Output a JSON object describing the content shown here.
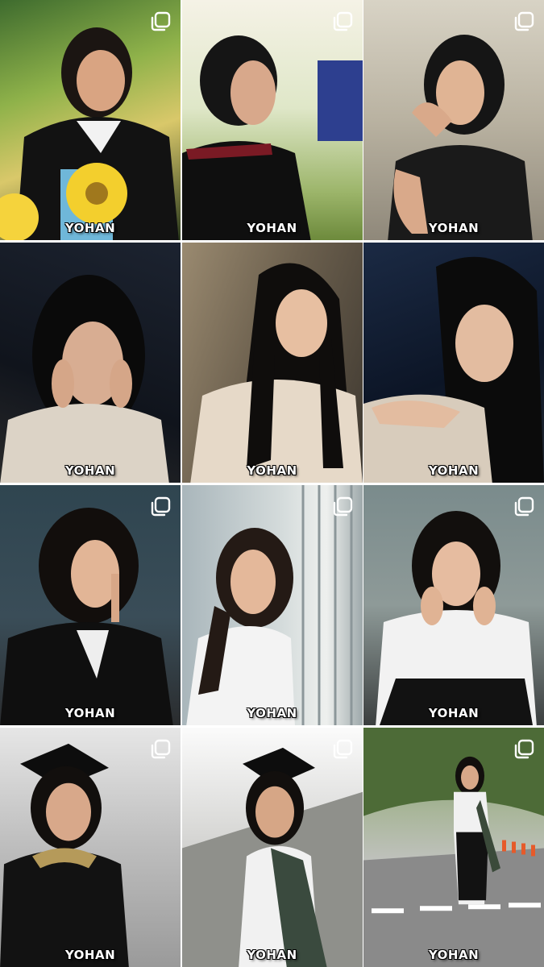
{
  "grid": {
    "tiles": [
      {
        "watermark": "YOHAN",
        "multi_photo": true
      },
      {
        "watermark": "YOHAN",
        "multi_photo": true
      },
      {
        "watermark": "YOHAN",
        "multi_photo": true
      },
      {
        "watermark": "YOHAN",
        "multi_photo": false
      },
      {
        "watermark": "YOHAN",
        "multi_photo": false
      },
      {
        "watermark": "YOHAN",
        "multi_photo": false
      },
      {
        "watermark": "YOHAN",
        "multi_photo": true
      },
      {
        "watermark": "YOHAN",
        "multi_photo": true
      },
      {
        "watermark": "YOHAN",
        "multi_photo": true
      },
      {
        "watermark": "YOHAN",
        "multi_photo": true
      },
      {
        "watermark": "YOHAN",
        "multi_photo": true
      },
      {
        "watermark": "YOHAN",
        "multi_photo": true
      }
    ]
  },
  "icons": {
    "multi_photo": "carousel-icon"
  },
  "colors": {
    "background": "#ffffff",
    "watermark": "#ffffff",
    "icon": "#ffffff"
  }
}
